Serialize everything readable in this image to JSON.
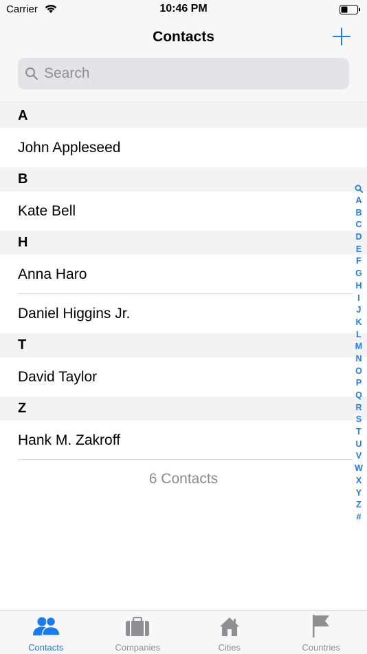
{
  "status_bar": {
    "carrier": "Carrier",
    "time": "10:46 PM"
  },
  "nav": {
    "title": "Contacts",
    "add_icon": "plus-icon"
  },
  "search": {
    "placeholder": "Search"
  },
  "sections": [
    {
      "letter": "A",
      "contacts": [
        "John Appleseed"
      ]
    },
    {
      "letter": "B",
      "contacts": [
        "Kate Bell"
      ]
    },
    {
      "letter": "H",
      "contacts": [
        "Anna Haro",
        "Daniel Higgins Jr."
      ]
    },
    {
      "letter": "T",
      "contacts": [
        "David Taylor"
      ]
    },
    {
      "letter": "Z",
      "contacts": [
        "Hank M. Zakroff"
      ]
    }
  ],
  "footer": {
    "count_label": "6 Contacts"
  },
  "index": [
    "A",
    "B",
    "C",
    "D",
    "E",
    "F",
    "G",
    "H",
    "I",
    "J",
    "K",
    "L",
    "M",
    "N",
    "O",
    "P",
    "Q",
    "R",
    "S",
    "T",
    "U",
    "V",
    "W",
    "X",
    "Y",
    "Z",
    "#"
  ],
  "tabs": [
    {
      "label": "Contacts",
      "icon": "people-icon",
      "active": true
    },
    {
      "label": "Companies",
      "icon": "briefcase-icon",
      "active": false
    },
    {
      "label": "Cities",
      "icon": "house-icon",
      "active": false
    },
    {
      "label": "Countries",
      "icon": "flag-icon",
      "active": false
    }
  ],
  "colors": {
    "accent": "#1a7cf5",
    "inactive": "#8e8e93",
    "bar_bg": "#f7f7f7",
    "section_bg": "#f3f3f4"
  }
}
